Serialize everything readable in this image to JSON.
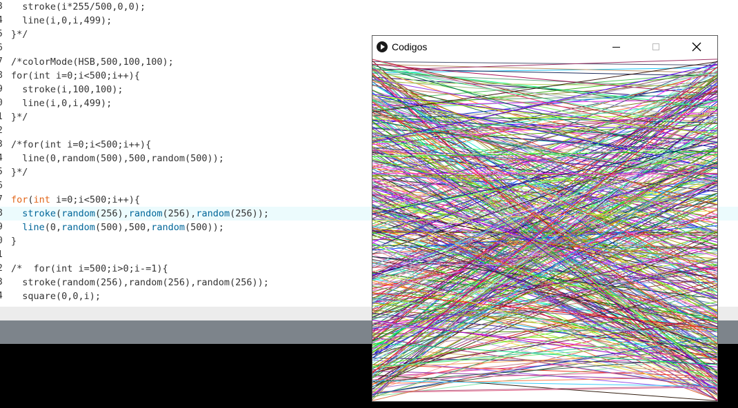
{
  "editor": {
    "lines": [
      {
        "num": "3",
        "segments": [
          {
            "t": "  stroke(i*255/500,0,0);",
            "c": ""
          }
        ]
      },
      {
        "num": "4",
        "segments": [
          {
            "t": "  line(i,0,i,499);",
            "c": ""
          }
        ]
      },
      {
        "num": "5",
        "segments": [
          {
            "t": "}*/",
            "c": ""
          }
        ]
      },
      {
        "num": "6",
        "segments": []
      },
      {
        "num": "7",
        "segments": [
          {
            "t": "/*colorMode(HSB,500,100,100);",
            "c": ""
          }
        ]
      },
      {
        "num": "8",
        "segments": [
          {
            "t": "for(int i=0;i<500;i++){",
            "c": ""
          }
        ]
      },
      {
        "num": "9",
        "segments": [
          {
            "t": "  stroke(i,100,100);",
            "c": ""
          }
        ]
      },
      {
        "num": "0",
        "segments": [
          {
            "t": "  line(i,0,i,499);",
            "c": ""
          }
        ]
      },
      {
        "num": "1",
        "segments": [
          {
            "t": "}*/",
            "c": ""
          }
        ]
      },
      {
        "num": "2",
        "segments": []
      },
      {
        "num": "3",
        "segments": [
          {
            "t": "/*for(int i=0;i<500;i++){",
            "c": ""
          }
        ]
      },
      {
        "num": "4",
        "segments": [
          {
            "t": "  line(0,random(500),500,random(500));",
            "c": ""
          }
        ]
      },
      {
        "num": "5",
        "segments": [
          {
            "t": "}*/",
            "c": ""
          }
        ]
      },
      {
        "num": "6",
        "segments": []
      },
      {
        "num": "7",
        "segments": [
          {
            "t": "for",
            "c": "kw"
          },
          {
            "t": "(",
            "c": ""
          },
          {
            "t": "int",
            "c": "kw"
          },
          {
            "t": " i=0;i<500;i++){",
            "c": ""
          }
        ]
      },
      {
        "num": "8",
        "current": true,
        "segments": [
          {
            "t": "  ",
            "c": ""
          },
          {
            "t": "stroke",
            "c": "fn"
          },
          {
            "t": "(",
            "c": ""
          },
          {
            "t": "random",
            "c": "fn"
          },
          {
            "t": "(256),",
            "c": ""
          },
          {
            "t": "random",
            "c": "fn"
          },
          {
            "t": "(256),",
            "c": ""
          },
          {
            "t": "random",
            "c": "fn"
          },
          {
            "t": "(256));",
            "c": ""
          }
        ]
      },
      {
        "num": "9",
        "segments": [
          {
            "t": "  ",
            "c": ""
          },
          {
            "t": "line",
            "c": "fn"
          },
          {
            "t": "(0,",
            "c": ""
          },
          {
            "t": "random",
            "c": "fn"
          },
          {
            "t": "(500),500,",
            "c": ""
          },
          {
            "t": "random",
            "c": "fn"
          },
          {
            "t": "(500));",
            "c": ""
          }
        ]
      },
      {
        "num": "0",
        "segments": [
          {
            "t": "}",
            "c": ""
          }
        ]
      },
      {
        "num": "1",
        "segments": []
      },
      {
        "num": "2",
        "segments": [
          {
            "t": "/*  for(int i=500;i>0;i-=1){",
            "c": ""
          }
        ]
      },
      {
        "num": "3",
        "segments": [
          {
            "t": "  stroke(random(256),random(256),random(256));",
            "c": ""
          }
        ]
      },
      {
        "num": "4",
        "segments": [
          {
            "t": "  square(0,0,i);",
            "c": ""
          }
        ]
      }
    ]
  },
  "sketch_window": {
    "title": "Codigos",
    "icon": "processing-play-icon",
    "minimize_icon": "minimize-icon",
    "maximize_icon": "maximize-icon",
    "close_icon": "close-icon",
    "canvas": {
      "line_count": 500,
      "background": "#ffffff"
    }
  },
  "colors": {
    "keyword": "#e2661a",
    "function": "#006699",
    "current_line": "#ecfbfd",
    "console_bg": "#000000",
    "toolbar_bg": "#7d848b"
  }
}
